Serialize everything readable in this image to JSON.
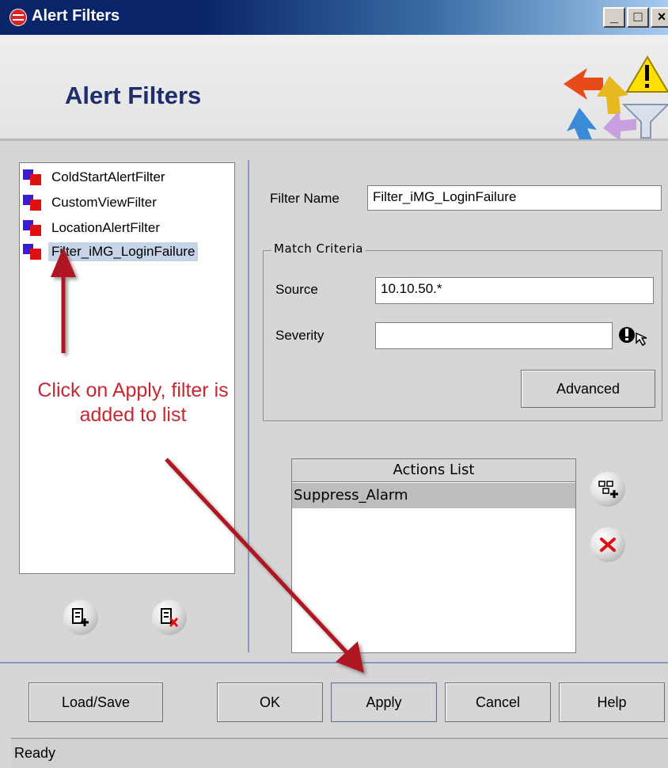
{
  "window": {
    "title": "Alert Filters",
    "minimize": "_",
    "maximize": "□",
    "close": "×"
  },
  "banner": {
    "title": "Alert Filters",
    "icon": "alert-filter-icon"
  },
  "filter_list": {
    "items": [
      {
        "label": "ColdStartAlertFilter",
        "selected": false
      },
      {
        "label": "CustomViewFilter",
        "selected": false
      },
      {
        "label": "LocationAlertFilter",
        "selected": false
      },
      {
        "label": "Filter_iMG_LoginFailure",
        "selected": true
      }
    ]
  },
  "form": {
    "filter_name_label": "Filter Name",
    "filter_name_value": "Filter_iMG_LoginFailure",
    "match_criteria_label": "Match Criteria",
    "source_label": "Source",
    "source_value": "10.10.50.*",
    "severity_label": "Severity",
    "severity_value": "",
    "advanced_label": "Advanced"
  },
  "actions": {
    "header": "Actions List",
    "rows": [
      "Suppress_Alarm"
    ]
  },
  "buttons": {
    "load_save": "Load/Save",
    "ok": "OK",
    "apply": "Apply",
    "cancel": "Cancel",
    "help": "Help"
  },
  "annotation": {
    "text": "Click on Apply, filter is added to list",
    "color": "#c62832"
  },
  "status": {
    "text": "Ready"
  },
  "colors": {
    "title_bar": "#0a246a",
    "banner_title": "#1f2d6b",
    "selection": "#c7d3e6",
    "arrow": "#b01820"
  }
}
